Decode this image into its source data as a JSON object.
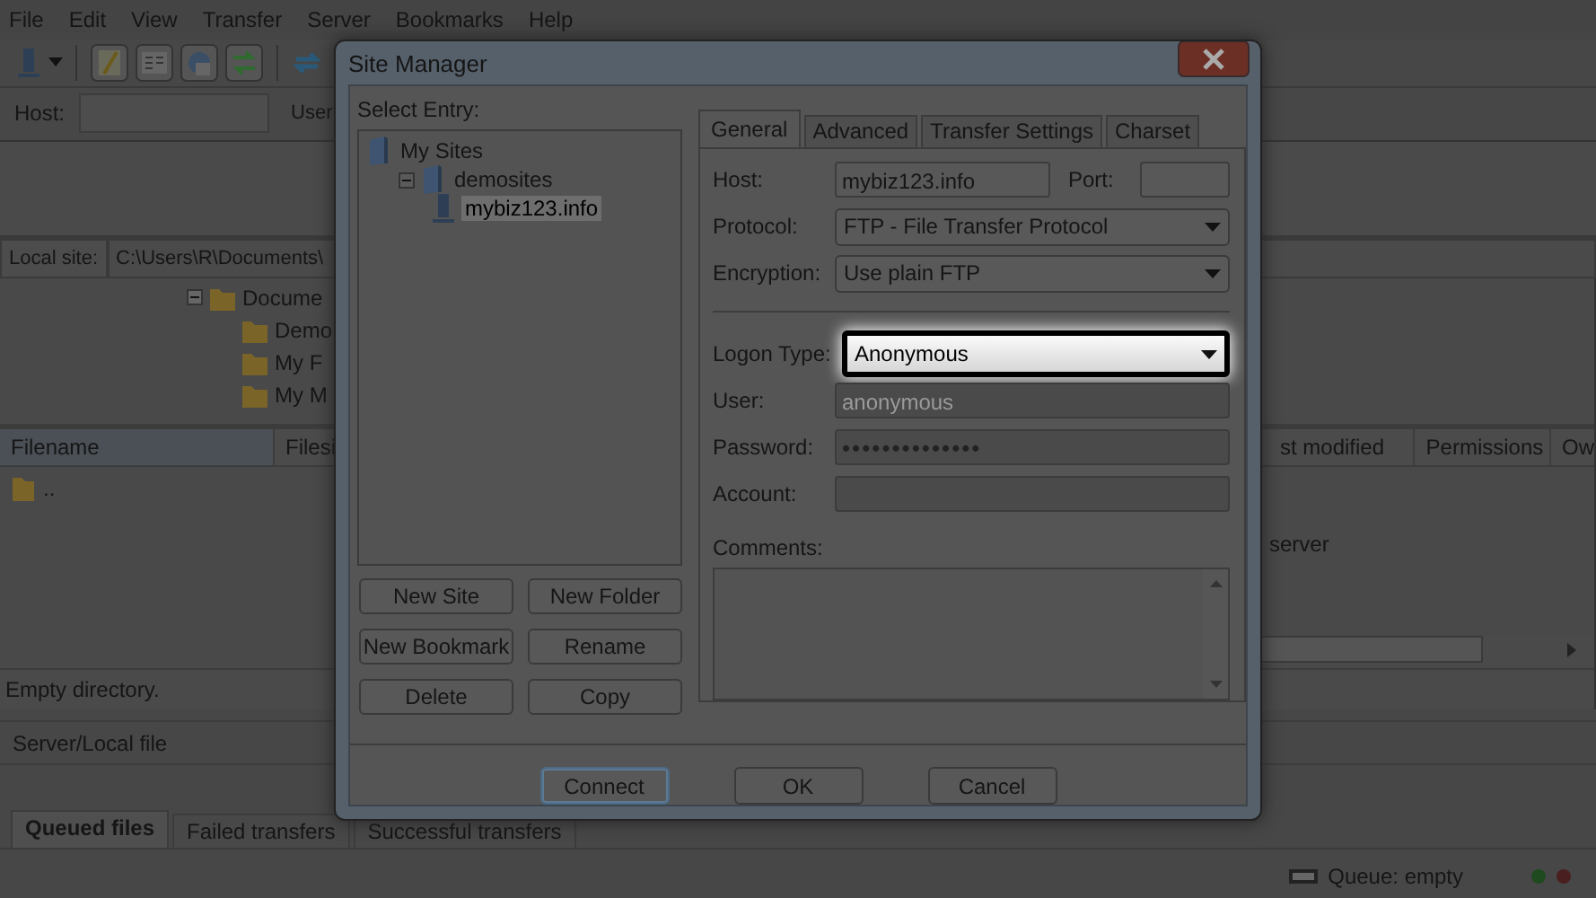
{
  "menu": [
    "File",
    "Edit",
    "View",
    "Transfer",
    "Server",
    "Bookmarks",
    "Help"
  ],
  "quickconnect": {
    "host_label": "Host:",
    "username_label": "User"
  },
  "local_site": {
    "label": "Local site:",
    "path": "C:\\Users\\R\\Documents\\"
  },
  "local_tree": [
    {
      "label": "Docume",
      "expanded": true,
      "children": [
        {
          "label": "Demo"
        },
        {
          "label": "My F"
        },
        {
          "label": "My M"
        }
      ]
    }
  ],
  "local_files": {
    "columns": [
      "Filename",
      "Filesi"
    ],
    "rows": [
      {
        "name": ".."
      }
    ],
    "status": "Empty directory."
  },
  "remote_files": {
    "columns": [
      "st modified",
      "Permissions",
      "Ow"
    ],
    "message": "server"
  },
  "queue": {
    "columns": [
      "Server/Local file"
    ],
    "tabs": [
      {
        "label": "Queued files",
        "selected": true
      },
      {
        "label": "Failed transfers",
        "selected": false
      },
      {
        "label": "Successful transfers",
        "selected": false
      }
    ]
  },
  "status_bar": {
    "queue": "Queue: empty"
  },
  "site_manager": {
    "title": "Site Manager",
    "select_entry_label": "Select Entry:",
    "tree": [
      {
        "label": "My Sites",
        "kind": "folder",
        "selected": false,
        "children": [
          {
            "label": "demosites",
            "kind": "folder",
            "selected": false,
            "expanded": true,
            "children": [
              {
                "label": "mybiz123.info",
                "kind": "site",
                "selected": true
              }
            ]
          }
        ]
      }
    ],
    "entry_buttons": [
      "New Site",
      "New Folder",
      "New Bookmark",
      "Rename",
      "Delete",
      "Copy"
    ],
    "tabs": [
      {
        "label": "General",
        "selected": true
      },
      {
        "label": "Advanced",
        "selected": false
      },
      {
        "label": "Transfer Settings",
        "selected": false
      },
      {
        "label": "Charset",
        "selected": false
      }
    ],
    "host": {
      "label": "Host:",
      "value": "mybiz123.info"
    },
    "port": {
      "label": "Port:"
    },
    "protocol": {
      "label": "Protocol:",
      "value": "FTP - File Transfer Protocol"
    },
    "encryption": {
      "label": "Encryption:",
      "value": "Use plain FTP"
    },
    "logon_type": {
      "label": "Logon Type:",
      "value": "Anonymous",
      "highlighted": true
    },
    "user": {
      "label": "User:",
      "value": "anonymous",
      "disabled": true
    },
    "password": {
      "label": "Password:",
      "value": "••••••••••••••",
      "disabled": true
    },
    "account": {
      "label": "Account:",
      "disabled": true
    },
    "comments": {
      "label": "Comments:"
    },
    "buttons": [
      {
        "label": "Connect",
        "default": true
      },
      {
        "label": "OK",
        "default": false
      },
      {
        "label": "Cancel",
        "default": false
      }
    ]
  }
}
